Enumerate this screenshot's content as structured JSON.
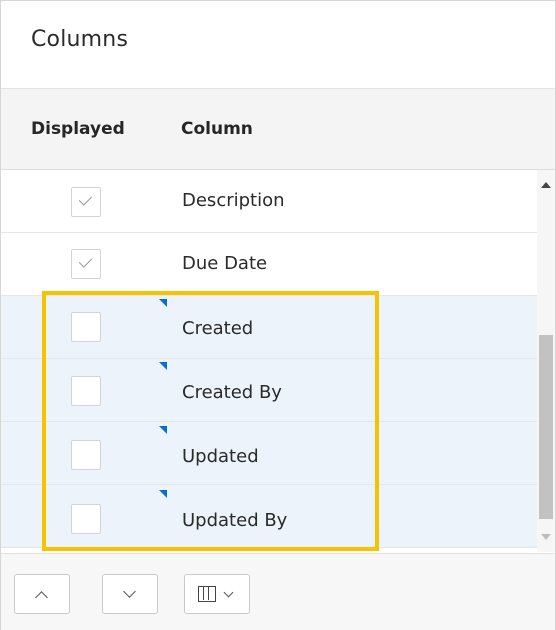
{
  "panel": {
    "title": "Columns"
  },
  "table_header": {
    "displayed_label": "Displayed",
    "column_label": "Column"
  },
  "rows": [
    {
      "name": "Description",
      "checked": true,
      "selected": false,
      "flagged": false
    },
    {
      "name": "Due Date",
      "checked": true,
      "selected": false,
      "flagged": false
    },
    {
      "name": "Created",
      "checked": false,
      "selected": true,
      "flagged": true
    },
    {
      "name": "Created By",
      "checked": false,
      "selected": true,
      "flagged": true
    },
    {
      "name": "Updated",
      "checked": false,
      "selected": true,
      "flagged": true
    },
    {
      "name": "Updated By",
      "checked": false,
      "selected": true,
      "flagged": true
    }
  ],
  "footer": {
    "buttons": [
      {
        "icon": "chevron-up-icon"
      },
      {
        "icon": "chevron-down-icon"
      },
      {
        "icon": "columns-icon",
        "extra_icon": "chevron-down-icon"
      }
    ]
  },
  "colors": {
    "highlight_border": "#f5c400",
    "selected_row_bg": "#edf3fb",
    "flag_marker": "#0b6fc7"
  }
}
